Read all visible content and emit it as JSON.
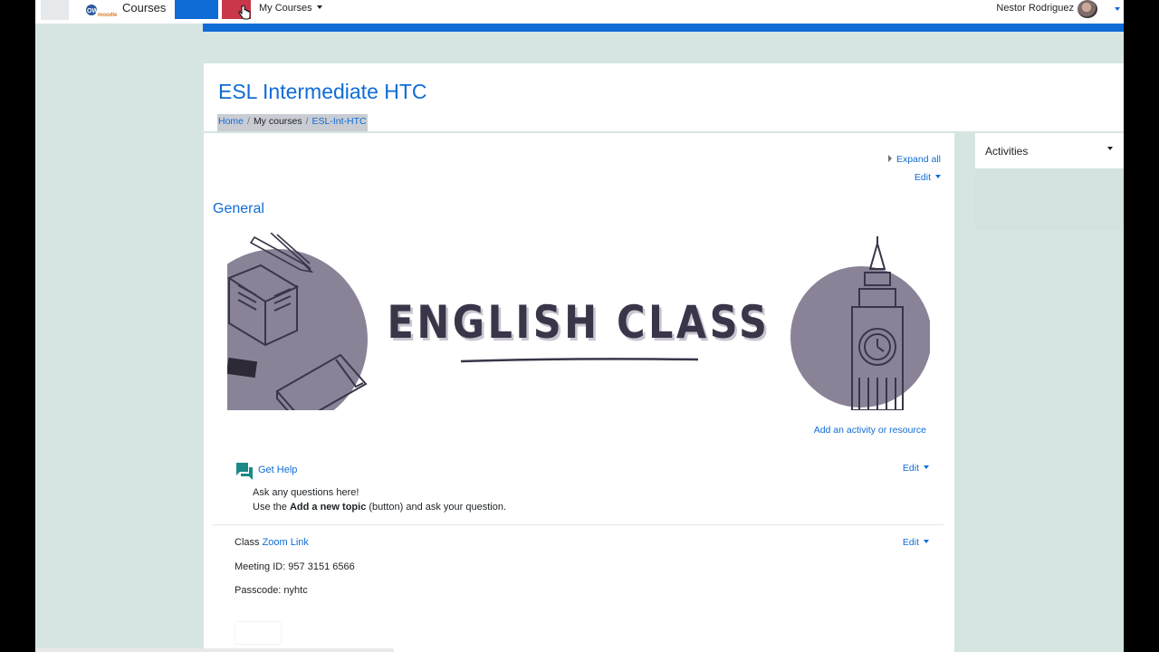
{
  "navbar": {
    "brand": "Courses",
    "my_courses": "My Courses",
    "user_name": "Nestor Rodriguez"
  },
  "header": {
    "title": "ESL Intermediate HTC",
    "breadcrumb": [
      "Home",
      "My courses",
      "ESL-Int-HTC"
    ]
  },
  "main": {
    "expand_all": "Expand all",
    "edit": "Edit",
    "section_title": "General",
    "banner_text": "ENGLISH CLASS",
    "add_activity": "Add an activity or resource",
    "get_help": {
      "link": "Get Help",
      "desc1": "Ask any questions here!",
      "desc2_pre": "Use the ",
      "desc2_bold": "Add a new topic",
      "desc2_post": " (button) and ask your question."
    },
    "zoom": {
      "prefix": "Class ",
      "link": "Zoom Link",
      "meeting_id": "Meeting ID: 957 3151 6566",
      "passcode": "Passcode: nyhtc"
    }
  },
  "blocks": {
    "activities_title": "Activities"
  },
  "colors": {
    "accent": "#0f6cd6",
    "page_bg": "#d6e5e2",
    "banner_ink": "#3a3548",
    "banner_circle": "#8a8398"
  }
}
